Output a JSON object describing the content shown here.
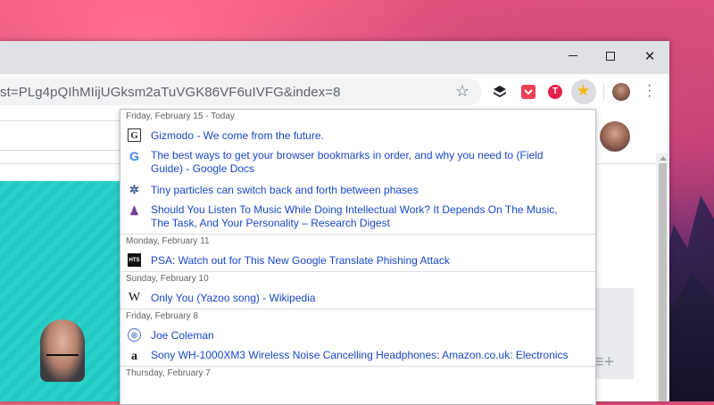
{
  "browser": {
    "url_text": "st=PLg4pQIhMIijUGksm2aTuVGK86VF6uIVFG&index=8",
    "ext_t_label": "T"
  },
  "history": [
    {
      "day": "Friday, February 15 - Today",
      "items": [
        {
          "title": "Gizmodo - We come from the future.",
          "icon": "gizmodo-favicon",
          "glyph": "G"
        },
        {
          "title": "The best ways to get your browser bookmarks in order, and why you need to (Field Guide) - Google Docs",
          "icon": "google-favicon",
          "glyph": "G"
        },
        {
          "title": "Tiny particles can switch back and forth between phases",
          "icon": "particles-favicon",
          "glyph": "✲"
        },
        {
          "title": "Should You Listen To Music While Doing Intellectual Work? It Depends On The Music, The Task, And Your Personality – Research Digest",
          "icon": "research-digest-favicon",
          "glyph": "♟"
        }
      ]
    },
    {
      "day": "Monday, February 11",
      "items": [
        {
          "title": "PSA: Watch out for This New Google Translate Phishing Attack",
          "icon": "hts-favicon",
          "glyph": "HTS"
        }
      ]
    },
    {
      "day": "Sunday, February 10",
      "items": [
        {
          "title": "Only You (Yazoo song) - Wikipedia",
          "icon": "wikipedia-favicon",
          "glyph": "W"
        }
      ]
    },
    {
      "day": "Friday, February 8",
      "items": [
        {
          "title": "Joe Coleman",
          "icon": "globe-favicon",
          "glyph": "◎"
        },
        {
          "title": "Sony WH-1000XM3 Wireless Noise Cancelling Headphones: Amazon.co.uk: Electronics",
          "icon": "amazon-favicon",
          "glyph": "a"
        }
      ]
    },
    {
      "day": "Thursday, February 7",
      "items": []
    }
  ],
  "colors": {
    "link": "#1a47c8",
    "accent_star": "#f7b500"
  }
}
